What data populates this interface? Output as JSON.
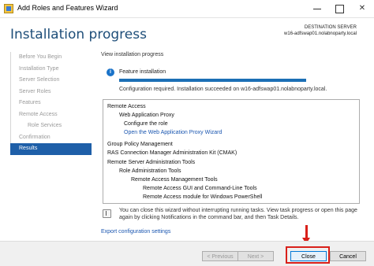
{
  "window": {
    "title": "Add Roles and Features Wizard",
    "controls": {
      "minimize": "",
      "maximize": "",
      "close": "✕"
    }
  },
  "header": {
    "title": "Installation progress",
    "destination_label": "DESTINATION SERVER",
    "destination_value": "w16-adfswap01.nolabnoparty.local"
  },
  "nav": {
    "items": [
      {
        "label": "Before You Begin",
        "state": "done"
      },
      {
        "label": "Installation Type",
        "state": "done"
      },
      {
        "label": "Server Selection",
        "state": "done"
      },
      {
        "label": "Server Roles",
        "state": "done"
      },
      {
        "label": "Features",
        "state": "done"
      },
      {
        "label": "Remote Access",
        "state": "done"
      },
      {
        "label": "Role Services",
        "state": "done",
        "sub": true
      },
      {
        "label": "Confirmation",
        "state": "done"
      },
      {
        "label": "Results",
        "state": "active"
      }
    ]
  },
  "content": {
    "view_label": "View installation progress",
    "status_title": "Feature installation",
    "progress_percent": 100,
    "config_message": "Configuration required. Installation succeeded on w16-adfswap01.nolabnoparty.local.",
    "results": [
      "Remote Access",
      "Web Application Proxy",
      "Configure the role",
      "Open the Web Application Proxy Wizard",
      "Group Policy Management",
      "RAS Connection Manager Administration Kit (CMAK)",
      "Remote Server Administration Tools",
      "Role Administration Tools",
      "Remote Access Management Tools",
      "Remote Access GUI and Command-Line Tools",
      "Remote Access module for Windows PowerShell"
    ],
    "hint": "You can close this wizard without interrupting running tasks. View task progress or open this page again by clicking Notifications in the command bar, and then Task Details.",
    "export_label": "Export configuration settings"
  },
  "footer": {
    "previous": "< Previous",
    "next": "Next >",
    "close": "Close",
    "cancel": "Cancel"
  },
  "colors": {
    "accent": "#1e5fa8",
    "title": "#1e4e79",
    "link": "#1a56b0",
    "annotation": "#d9201a"
  }
}
